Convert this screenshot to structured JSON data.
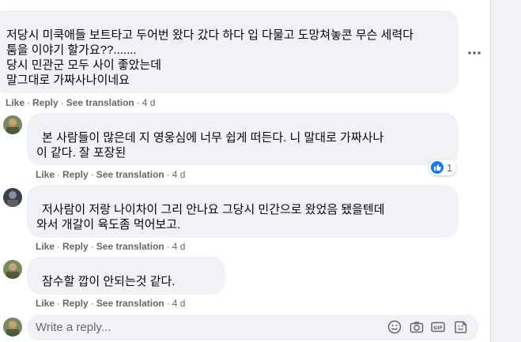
{
  "comments": [
    {
      "author": "",
      "lines": [
        "저당시 미쿡애들 보트타고 두어번 왔다 갔다 하다 입 다물고 도망쳐놓콘 무슨 세력다",
        "툼을 이야기 할가요??.......",
        "당시 민관군 모두 사이 좋았는데",
        "말그대로 가짜사나이네요"
      ],
      "actions": {
        "like": "Like",
        "reply": "Reply",
        "translate": "See translation",
        "time": "4 d"
      }
    },
    {
      "author": "",
      "mention": "",
      "lines": [
        "본 사람들이 많은데 지 영웅심에 너무 쉽게 떠든다. 니 말대로 가짜사나",
        "이 같다. 잘 포장된"
      ],
      "reaction_count": "1",
      "actions": {
        "like": "Like",
        "reply": "Reply",
        "translate": "See translation",
        "time": "4 d"
      }
    },
    {
      "author": "",
      "mention": "",
      "lines": [
        "저사람이 저랑 나이차이 그리 안나요 그당시 민간으로 왔었음 됐을텐데",
        "와서 개갈이 육도좀 먹어보고."
      ],
      "actions": {
        "like": "Like",
        "reply": "Reply",
        "translate": "See translation",
        "time": "4 d"
      }
    },
    {
      "author": "",
      "mention": "",
      "lines": [
        "잠수할 깝이 안되는것 같다."
      ],
      "actions": {
        "like": "Like",
        "reply": "Reply",
        "translate": "See translation",
        "time": "4 d"
      }
    }
  ],
  "reply_box": {
    "placeholder": "Write a reply..."
  },
  "icons": {
    "more": "more-options-icon",
    "emoji": "emoji-icon",
    "camera": "camera-icon",
    "gif": "gif-icon",
    "sticker": "sticker-icon",
    "like_reaction": "like-reaction-icon"
  },
  "colors": {
    "bubble": "#f0f2f5",
    "meta_text": "#65676b",
    "like_blue": "#1877f2"
  }
}
